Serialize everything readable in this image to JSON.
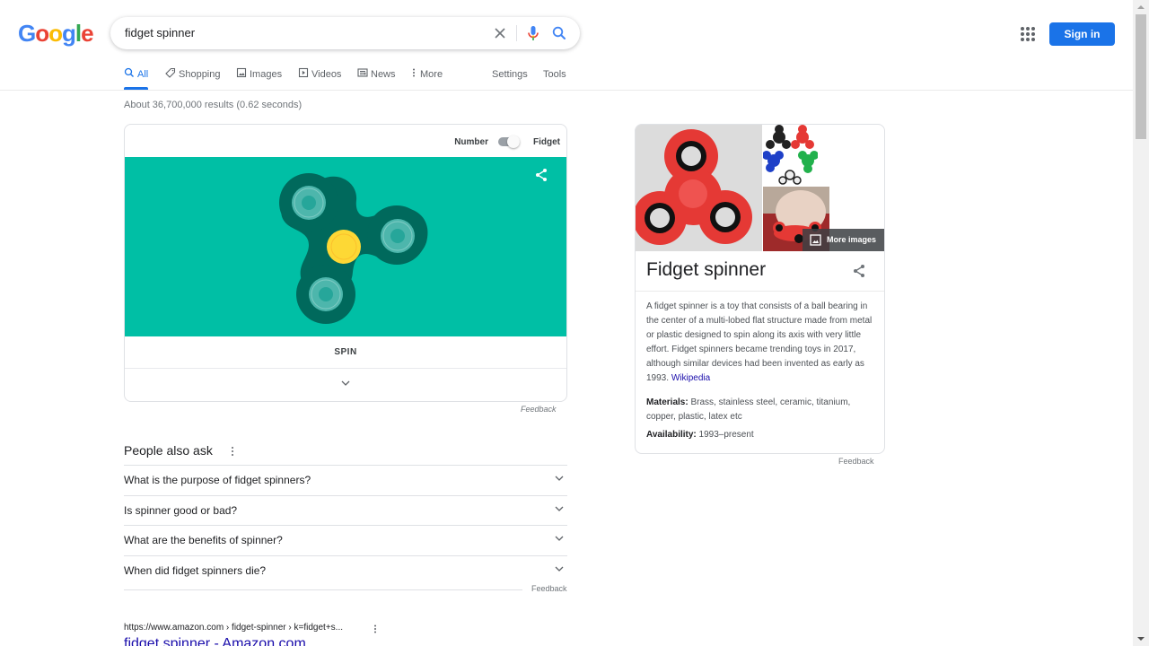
{
  "header": {
    "logo_letters": [
      {
        "ch": "G",
        "color": "#4285f4"
      },
      {
        "ch": "o",
        "color": "#ea4335"
      },
      {
        "ch": "o",
        "color": "#fbbc05"
      },
      {
        "ch": "g",
        "color": "#4285f4"
      },
      {
        "ch": "l",
        "color": "#34a853"
      },
      {
        "ch": "e",
        "color": "#ea4335"
      }
    ],
    "search_value": "fidget spinner",
    "clear_icon": "close-icon",
    "mic_icon": "microphone-icon",
    "search_icon": "search-icon",
    "apps_icon": "apps-grid-icon",
    "signin_label": "Sign in",
    "accent_color": "#1a73e8"
  },
  "tabs": [
    {
      "label": "All",
      "icon": "search-icon",
      "active": true
    },
    {
      "label": "Shopping",
      "icon": "tag-icon",
      "active": false
    },
    {
      "label": "Images",
      "icon": "image-icon",
      "active": false
    },
    {
      "label": "Videos",
      "icon": "play-icon",
      "active": false
    },
    {
      "label": "News",
      "icon": "newspaper-icon",
      "active": false
    },
    {
      "label": "More",
      "icon": "more-vert-icon",
      "active": false
    }
  ],
  "tools": {
    "settings": "Settings",
    "tools": "Tools"
  },
  "result_stats": "About 36,700,000 results (0.62 seconds)",
  "spinner_widget": {
    "toggle_left_label": "Number",
    "toggle_right_label": "Fidget",
    "toggle_on": true,
    "stage_color": "#00bfa5",
    "spinner_body_color": "#00695c",
    "center_color": "#fdd835",
    "spin_label": "SPIN",
    "feedback": "Feedback"
  },
  "people_also_ask": {
    "title": "People also ask",
    "questions": [
      "What is the purpose of fidget spinners?",
      "Is spinner good or bad?",
      "What are the benefits of spinner?",
      "When did fidget spinners die?"
    ],
    "feedback": "Feedback"
  },
  "result": {
    "cite": "https://www.amazon.com › fidget-spinner › k=fidget+s...",
    "title": "fidget spinner - Amazon.com"
  },
  "knowledge_panel": {
    "more_images": "More images",
    "title": "Fidget spinner",
    "description": "A fidget spinner is a toy that consists of a ball bearing in the center of a multi-lobed flat structure made from metal or plastic designed to spin along its axis with very little effort. Fidget spinners became trending toys in 2017, although similar devices had been invented as early as 1993.",
    "source": "Wikipedia",
    "facts": [
      {
        "label": "Materials:",
        "value": "Brass, stainless steel, ceramic, titanium, copper, plastic, latex etc"
      },
      {
        "label": "Availability:",
        "value": "1993–present"
      }
    ],
    "feedback": "Feedback"
  }
}
